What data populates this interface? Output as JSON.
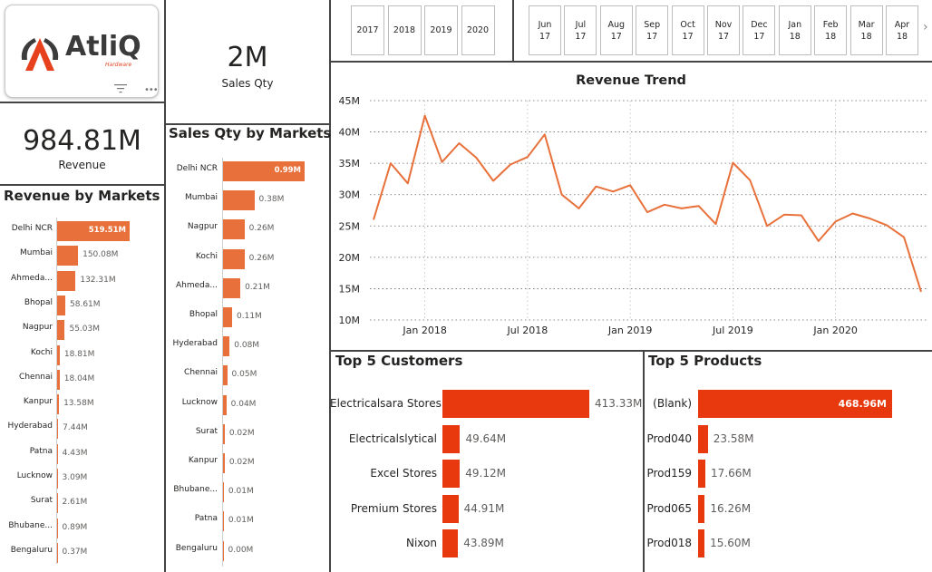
{
  "brand": {
    "name": "AtliQ",
    "tagline": "Hardware"
  },
  "kpis": {
    "sales_qty": {
      "value": "2M",
      "label": "Sales Qty"
    },
    "revenue": {
      "value": "984.81M",
      "label": "Revenue"
    }
  },
  "year_slicer": [
    "2017",
    "2018",
    "2019",
    "2020"
  ],
  "month_slicer": [
    {
      "month": "Jun",
      "year": "17"
    },
    {
      "month": "Jul",
      "year": "17"
    },
    {
      "month": "Aug",
      "year": "17"
    },
    {
      "month": "Sep",
      "year": "17"
    },
    {
      "month": "Oct",
      "year": "17"
    },
    {
      "month": "Nov",
      "year": "17"
    },
    {
      "month": "Dec",
      "year": "17"
    },
    {
      "month": "Jan",
      "year": "18"
    },
    {
      "month": "Feb",
      "year": "18"
    },
    {
      "month": "Mar",
      "year": "18"
    },
    {
      "month": "Apr",
      "year": "18"
    }
  ],
  "icons": {
    "filter": "filter-lines-icon",
    "more": "more-options-icon",
    "next": "chevron-right-icon",
    "logo": "atliq-logo-icon"
  },
  "colors": {
    "bar": "#e8703a",
    "top5_bar": "#e8380d",
    "line": "#e8703a",
    "logo_red": "#e8411d"
  },
  "revenue_by_markets": {
    "title": "Revenue by Markets",
    "items": [
      {
        "label": "Delhi NCR",
        "value": 519.51,
        "display": "519.51M"
      },
      {
        "label": "Mumbai",
        "value": 150.08,
        "display": "150.08M"
      },
      {
        "label": "Ahmeda...",
        "value": 132.31,
        "display": "132.31M"
      },
      {
        "label": "Bhopal",
        "value": 58.61,
        "display": "58.61M"
      },
      {
        "label": "Nagpur",
        "value": 55.03,
        "display": "55.03M"
      },
      {
        "label": "Kochi",
        "value": 18.81,
        "display": "18.81M"
      },
      {
        "label": "Chennai",
        "value": 18.04,
        "display": "18.04M"
      },
      {
        "label": "Kanpur",
        "value": 13.58,
        "display": "13.58M"
      },
      {
        "label": "Hyderabad",
        "value": 7.44,
        "display": "7.44M"
      },
      {
        "label": "Patna",
        "value": 4.43,
        "display": "4.43M"
      },
      {
        "label": "Lucknow",
        "value": 3.09,
        "display": "3.09M"
      },
      {
        "label": "Surat",
        "value": 2.61,
        "display": "2.61M"
      },
      {
        "label": "Bhubane...",
        "value": 0.89,
        "display": "0.89M"
      },
      {
        "label": "Bengaluru",
        "value": 0.37,
        "display": "0.37M"
      }
    ]
  },
  "sales_qty_by_markets": {
    "title": "Sales Qty by Markets",
    "items": [
      {
        "label": "Delhi NCR",
        "value": 0.99,
        "display": "0.99M"
      },
      {
        "label": "Mumbai",
        "value": 0.38,
        "display": "0.38M"
      },
      {
        "label": "Nagpur",
        "value": 0.26,
        "display": "0.26M"
      },
      {
        "label": "Kochi",
        "value": 0.26,
        "display": "0.26M"
      },
      {
        "label": "Ahmeda...",
        "value": 0.21,
        "display": "0.21M"
      },
      {
        "label": "Bhopal",
        "value": 0.11,
        "display": "0.11M"
      },
      {
        "label": "Hyderabad",
        "value": 0.08,
        "display": "0.08M"
      },
      {
        "label": "Chennai",
        "value": 0.05,
        "display": "0.05M"
      },
      {
        "label": "Lucknow",
        "value": 0.04,
        "display": "0.04M"
      },
      {
        "label": "Surat",
        "value": 0.02,
        "display": "0.02M"
      },
      {
        "label": "Kanpur",
        "value": 0.02,
        "display": "0.02M"
      },
      {
        "label": "Bhubane...",
        "value": 0.01,
        "display": "0.01M"
      },
      {
        "label": "Patna",
        "value": 0.01,
        "display": "0.01M"
      },
      {
        "label": "Bengaluru",
        "value": 0.0,
        "display": "0.00M"
      }
    ]
  },
  "top_customers": {
    "title": "Top 5 Customers",
    "items": [
      {
        "label": "Electricalsara Stores",
        "value": 413.33,
        "display": "413.33M"
      },
      {
        "label": "Electricalslytical",
        "value": 49.64,
        "display": "49.64M"
      },
      {
        "label": "Excel Stores",
        "value": 49.12,
        "display": "49.12M"
      },
      {
        "label": "Premium Stores",
        "value": 44.91,
        "display": "44.91M"
      },
      {
        "label": "Nixon",
        "value": 43.89,
        "display": "43.89M"
      }
    ]
  },
  "top_products": {
    "title": "Top 5 Products",
    "items": [
      {
        "label": "(Blank)",
        "value": 468.96,
        "display": "468.96M"
      },
      {
        "label": "Prod040",
        "value": 23.58,
        "display": "23.58M"
      },
      {
        "label": "Prod159",
        "value": 17.66,
        "display": "17.66M"
      },
      {
        "label": "Prod065",
        "value": 16.26,
        "display": "16.26M"
      },
      {
        "label": "Prod018",
        "value": 15.6,
        "display": "15.60M"
      }
    ]
  },
  "chart_data": {
    "type": "line",
    "title": "Revenue Trend",
    "xlabel": "",
    "ylabel": "",
    "x": [
      "2017-10",
      "2017-11",
      "2017-12",
      "2018-01",
      "2018-02",
      "2018-03",
      "2018-04",
      "2018-05",
      "2018-06",
      "2018-07",
      "2018-08",
      "2018-09",
      "2018-10",
      "2018-11",
      "2018-12",
      "2019-01",
      "2019-02",
      "2019-03",
      "2019-04",
      "2019-05",
      "2019-06",
      "2019-07",
      "2019-08",
      "2019-09",
      "2019-10",
      "2019-11",
      "2019-12",
      "2020-01",
      "2020-02",
      "2020-03",
      "2020-04",
      "2020-05",
      "2020-06"
    ],
    "values": [
      26,
      35,
      31.8,
      42.6,
      35.2,
      38.2,
      35.9,
      32.2,
      34.8,
      36,
      39.6,
      30,
      27.8,
      31.3,
      30.5,
      31.5,
      27.2,
      28.4,
      27.8,
      28.2,
      25.3,
      35.1,
      32.3,
      25,
      26.8,
      26.7,
      22.6,
      25.7,
      27,
      26.2,
      25.1,
      23.2,
      14.5
    ],
    "x_ticks": [
      "Jan 2018",
      "Jul 2018",
      "Jan 2019",
      "Jul 2019",
      "Jan 2020"
    ],
    "y_ticks": [
      "10M",
      "15M",
      "20M",
      "25M",
      "30M",
      "35M",
      "40M",
      "45M"
    ],
    "ylim": [
      10,
      45
    ],
    "grid": true
  }
}
